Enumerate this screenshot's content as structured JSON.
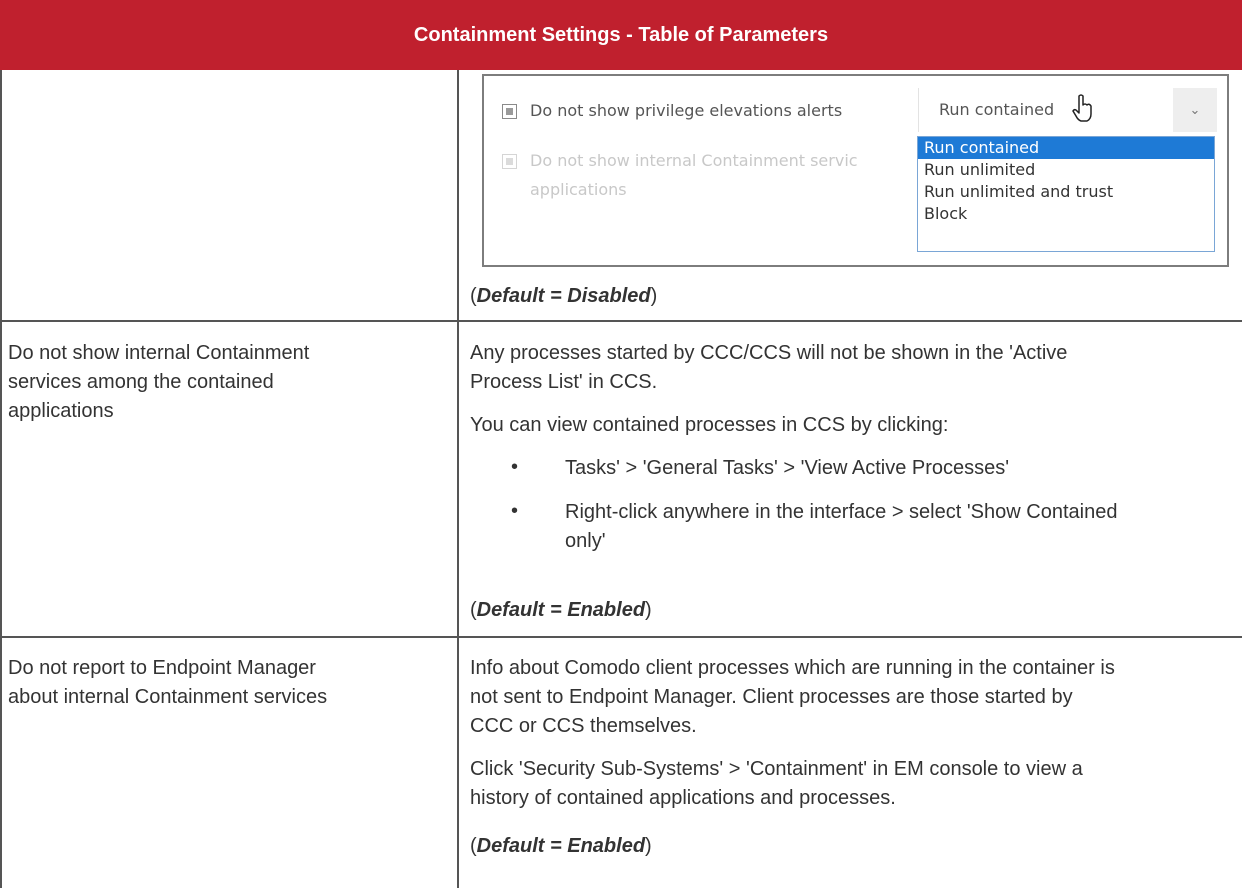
{
  "header": {
    "title": "Containment Settings - Table of Parameters"
  },
  "screenshot": {
    "option1_label": "Do not show privilege elevations alerts",
    "option2_label": "Do not show internal Containment servic",
    "option2_label_line2": "applications",
    "dropdown": {
      "selected": "Run contained",
      "options": [
        "Run contained",
        "Run unlimited",
        "Run unlimited and trust",
        "Block"
      ]
    }
  },
  "rows": [
    {
      "default": "(Default = Disabled)"
    },
    {
      "parameter": [
        "Do not show internal Containment",
        "services among the contained",
        "applications"
      ],
      "description": [
        "Any processes started by CCC/CCS will not be shown in the 'Active",
        "Process List' in CCS.",
        "You can view contained processes in CCS by clicking:"
      ],
      "bullets": [
        [
          "Tasks' > 'General Tasks' > 'View Active Processes'"
        ],
        [
          "Right-click anywhere in the interface > select 'Show Contained",
          "only'"
        ]
      ],
      "default": "(Default = Enabled)"
    },
    {
      "parameter": [
        "Do not report to Endpoint Manager",
        "about internal Containment services"
      ],
      "description": [
        "Info about Comodo client processes which are running in the container is",
        "not sent to Endpoint Manager. Client processes are those started by",
        "CCC or CCS themselves.",
        "Click 'Security Sub-Systems' > 'Containment' in EM console to view a",
        "history of contained applications and processes."
      ],
      "default": "(Default = Enabled)"
    }
  ]
}
